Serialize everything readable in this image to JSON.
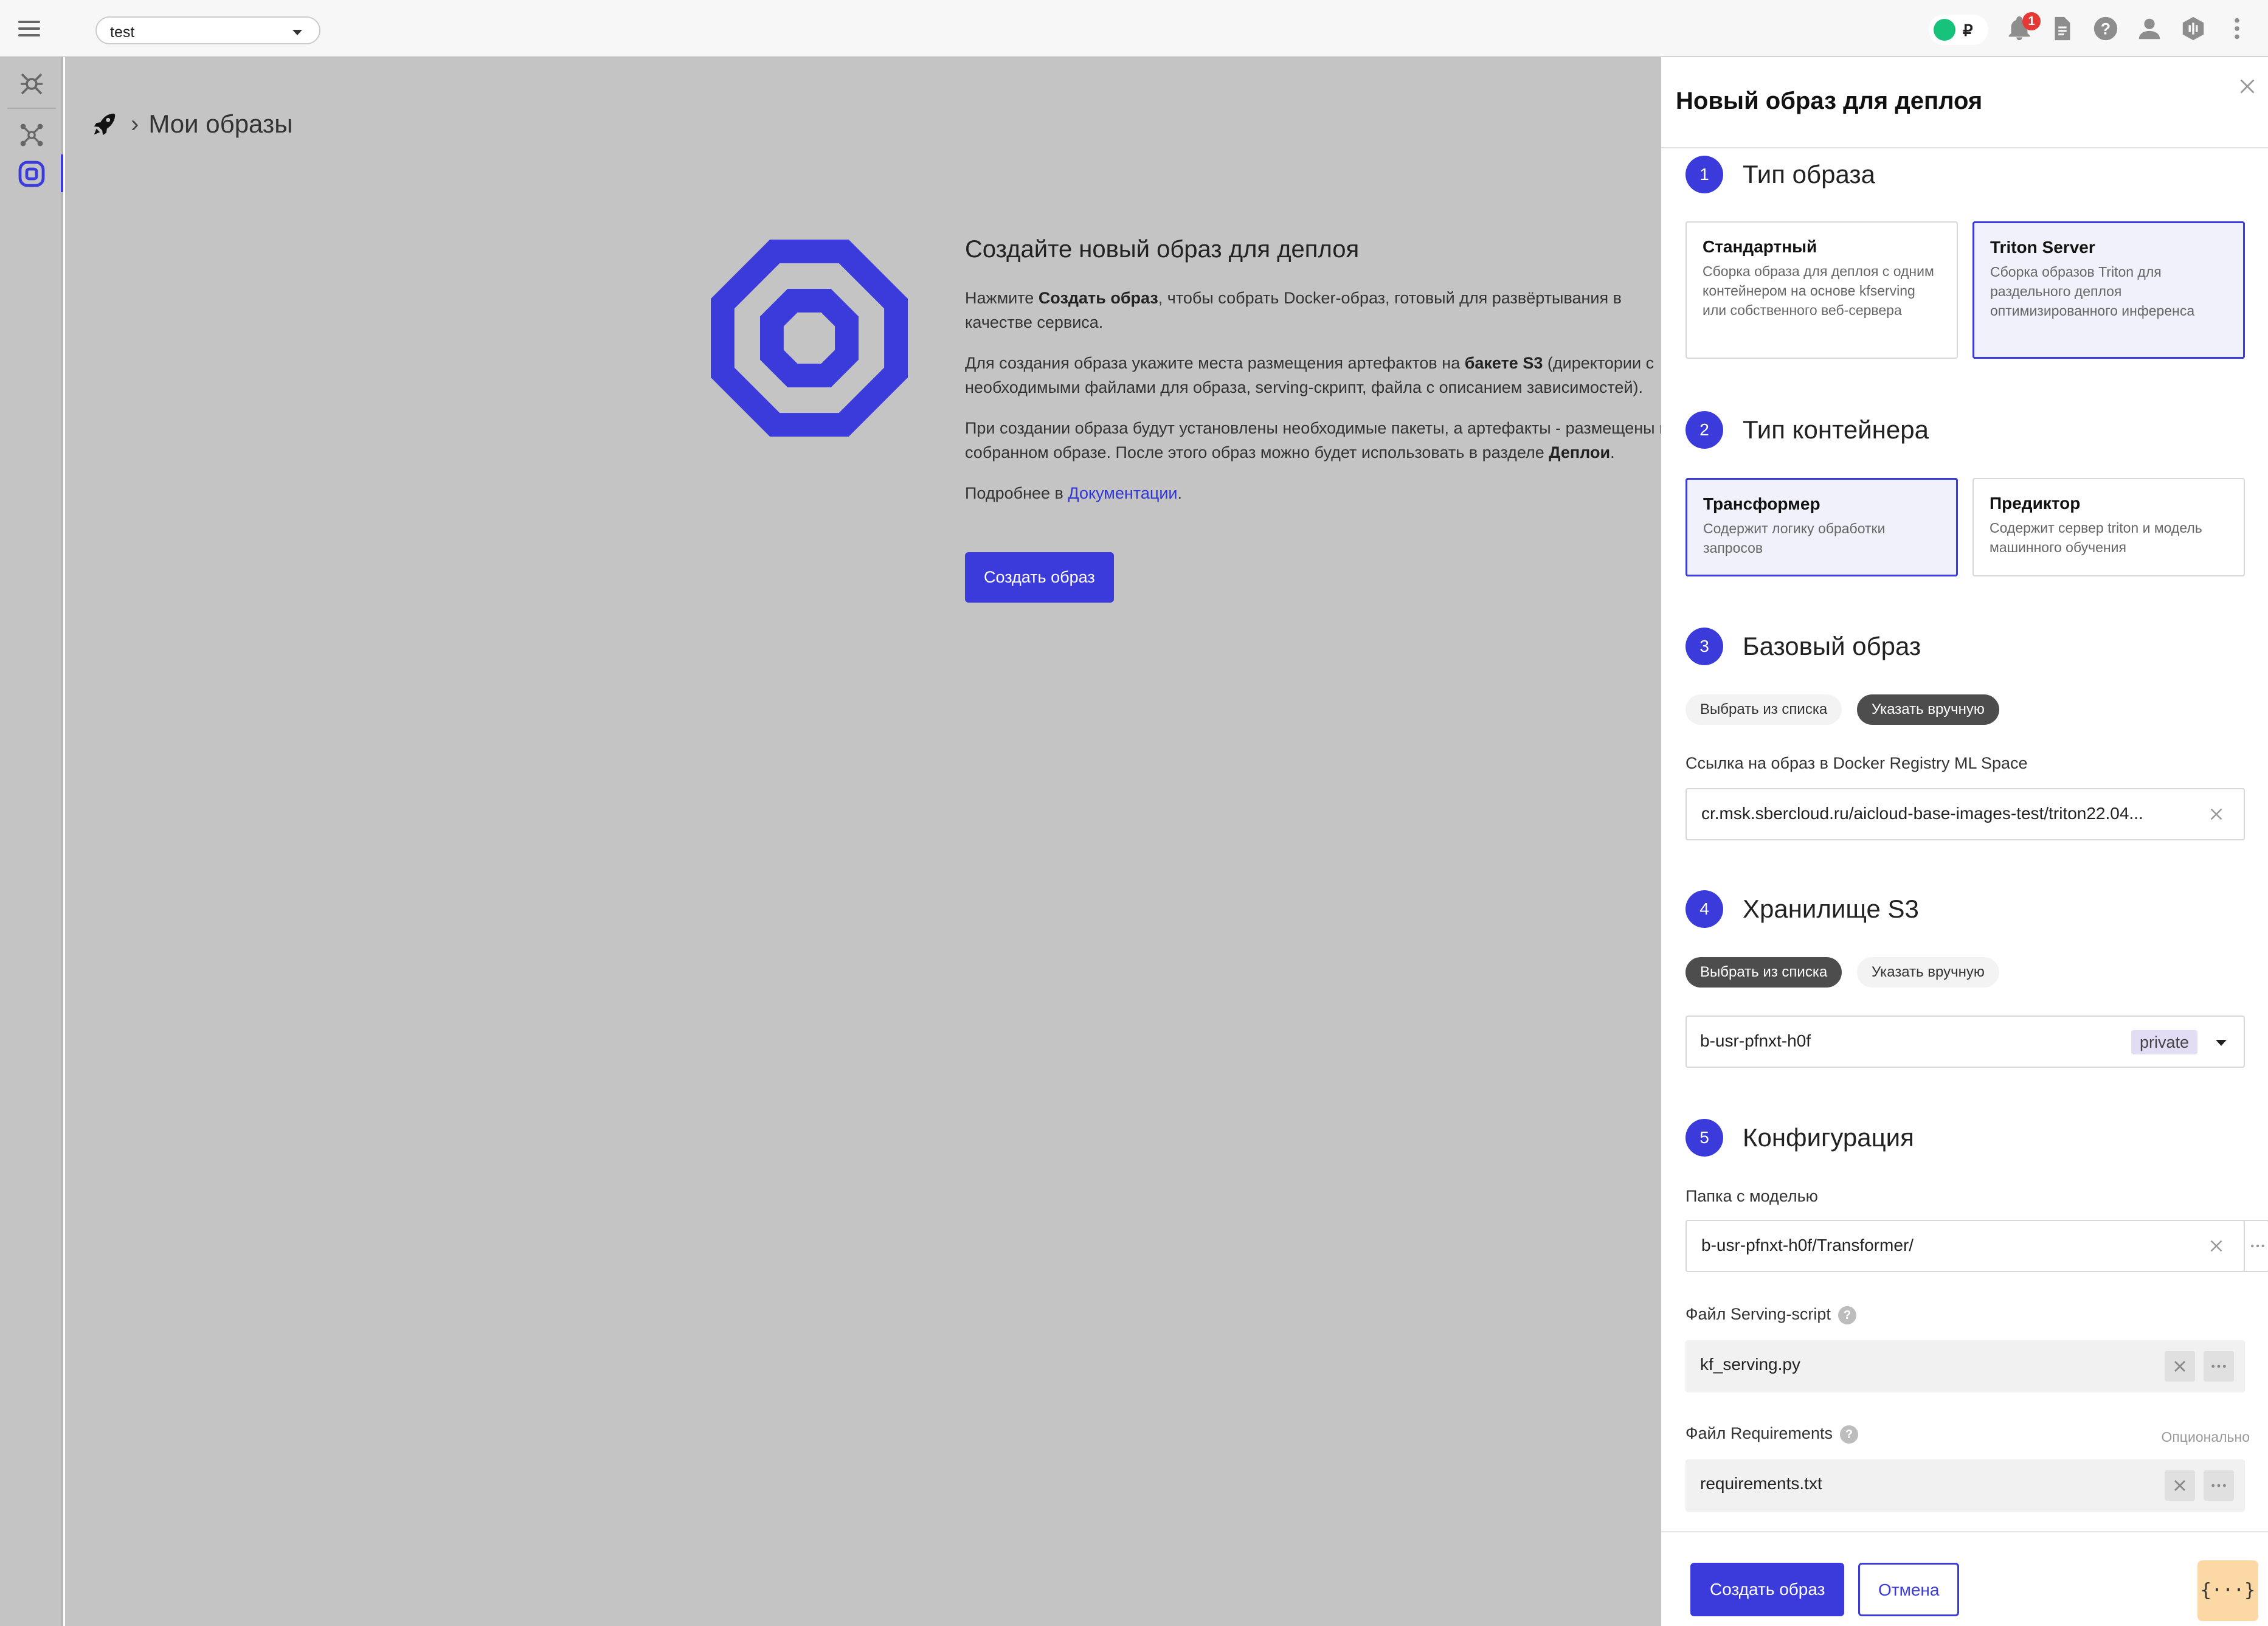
{
  "topbar": {
    "project": "test",
    "currency": "₽",
    "notifications_count": "1",
    "icons": [
      "menu-icon",
      "balance-icon",
      "bell-icon",
      "document-icon",
      "help-icon",
      "user-icon",
      "support-icon",
      "more-vertical-icon"
    ]
  },
  "rail": {
    "icons": [
      "environments-icon",
      "graph-icon",
      "images-icon"
    ],
    "active": "images-icon",
    "collapse_icon": "collapse-left-icon"
  },
  "breadcrumb": {
    "icon": "rocket-icon",
    "current": "Мои образы"
  },
  "hero": {
    "title": "Создайте новый образ для деплоя",
    "p1_a": "Нажмите ",
    "p1_b": "Создать образ",
    "p1_c": ", чтобы собрать Docker-образ, готовый для развёртывания в качестве сервиса.",
    "p2_a": "Для создания образа укажите места размещения артефактов на ",
    "p2_b": "бакете S3",
    "p2_c": " (директории с необходимыми файлами для образа, serving-скрипт, файла с описанием зависимостей).",
    "p3_a": "При создании образа будут установлены необходимые пакеты, а артефакты - размещены в собранном образе. После этого образ можно будет использовать в разделе ",
    "p3_b": "Деплои",
    "p3_c": ".",
    "p4_a": "Подробнее в ",
    "p4_link": "Документации",
    "p4_c": ".",
    "button": "Создать образ",
    "accent": "#3b3bdc"
  },
  "panel": {
    "title": "Новый образ для деплоя",
    "steps": [
      {
        "num": "1",
        "title": "Тип образа"
      },
      {
        "num": "2",
        "title": "Тип контейнера"
      },
      {
        "num": "3",
        "title": "Базовый образ"
      },
      {
        "num": "4",
        "title": "Хранилище S3"
      },
      {
        "num": "5",
        "title": "Конфигурация"
      }
    ],
    "image_types": [
      {
        "title": "Стандартный",
        "desc": "Сборка образа для деплоя с одним контейнером на основе kfserving или собственного веб-сервера",
        "selected": false
      },
      {
        "title": "Triton Server",
        "desc": "Сборка образов Triton для раздельного деплоя оптимизированного инференса",
        "selected": true
      }
    ],
    "container_types": [
      {
        "title": "Трансформер",
        "desc": "Содержит логику обработки запросов",
        "selected": true
      },
      {
        "title": "Предиктор",
        "desc": "Содержит сервер triton и модель машинного обучения",
        "selected": false
      }
    ],
    "base_image": {
      "tab_list": "Выбрать из списка",
      "tab_manual": "Указать вручную",
      "active": "manual",
      "label": "Ссылка на образ в Docker Registry ML Space",
      "value": "cr.msk.sbercloud.ru/aicloud-base-images-test/triton22.04..."
    },
    "s3": {
      "tab_list": "Выбрать из списка",
      "tab_manual": "Указать вручную",
      "active": "list",
      "bucket": "b-usr-pfnxt-h0f",
      "tag": "private"
    },
    "config": {
      "model_folder_label": "Папка с моделью",
      "model_folder_value": "b-usr-pfnxt-h0f/Transformer/",
      "serving_label": "Файл Serving-script",
      "serving_value": "kf_serving.py",
      "requirements_label": "Файл Requirements",
      "requirements_optional": "Опционально",
      "requirements_value": "requirements.txt",
      "help_glyph": "?"
    },
    "footer": {
      "create": "Создать образ",
      "cancel": "Отмена",
      "json": "{···}"
    }
  }
}
